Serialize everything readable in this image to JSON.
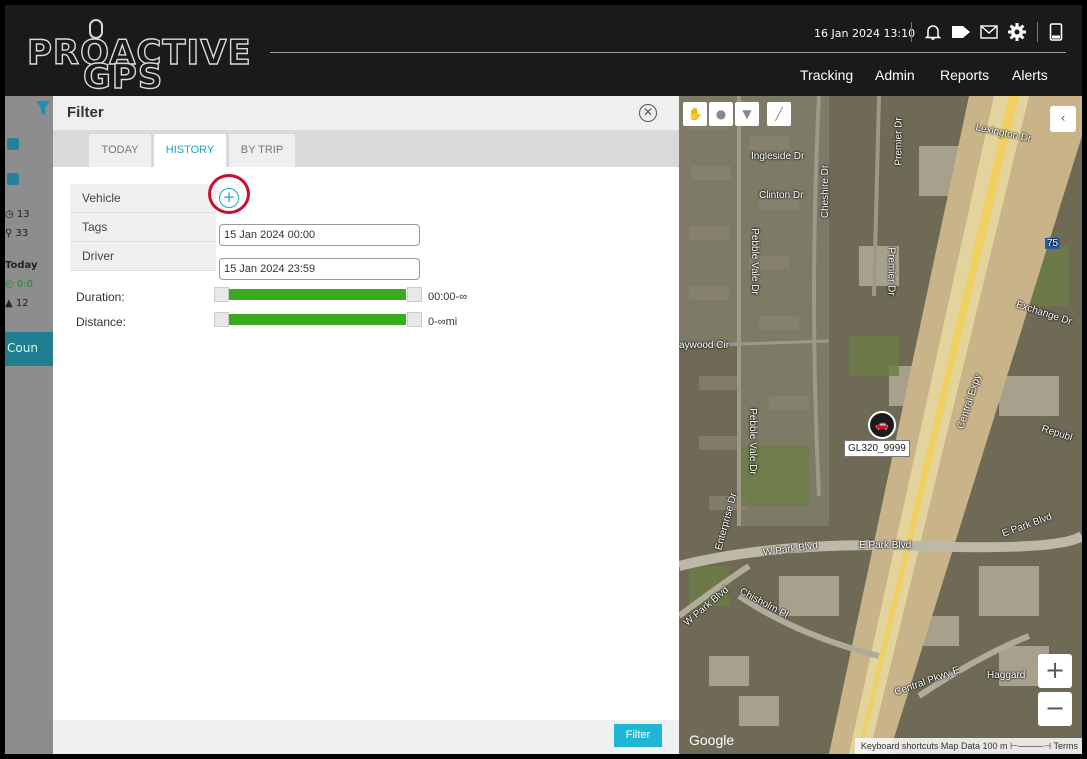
{
  "header": {
    "logo_line1": "PROACTIVE",
    "logo_line2": "GPS",
    "datetime": "16 Jan 2024 13:10",
    "nav": [
      "Tracking",
      "Admin",
      "Reports",
      "Alerts"
    ],
    "icons": [
      "bell-icon",
      "tag-icon",
      "mail-icon",
      "gear-icon",
      "phone-icon"
    ]
  },
  "left_strip": {
    "rows": [
      "13",
      "33",
      "Today",
      "0:0",
      "12"
    ],
    "button": "Coun"
  },
  "filter": {
    "title": "Filter",
    "tabs": [
      {
        "label": "TODAY",
        "active": false
      },
      {
        "label": "HISTORY",
        "active": true
      },
      {
        "label": "BY TRIP",
        "active": false
      }
    ],
    "menu": [
      "Vehicle",
      "Tags",
      "Driver"
    ],
    "start": "15 Jan 2024 00:00",
    "end": "15 Jan 2024 23:59",
    "duration_label": "Duration:",
    "duration_value": "00:00-∞",
    "distance_label": "Distance:",
    "distance_value": "0-∞mi",
    "button": "Filter"
  },
  "map": {
    "streets": [
      "Lexington Dr",
      "Ingleside Dr",
      "Premier Dr",
      "Clinton Dr",
      "Cheshire Dr",
      "Pebble Vale Dr",
      "Premier Dr",
      "Exchange Dr",
      "aywood Cir",
      "Central Expy",
      "Pebble Vale Dr",
      "Republ",
      "Enterprise Dr",
      "W Park Blvd",
      "E Park Blvd",
      "E Park Blvd",
      "W Park Blvd",
      "Chisholm Pl",
      "Central Pkwy E",
      "Haggard",
      "75"
    ],
    "vehicle_tag": "GL320_9999",
    "google": "Google",
    "attribution": "Keyboard shortcuts   Map Data   100 m ⊢────⊣   Terms"
  }
}
